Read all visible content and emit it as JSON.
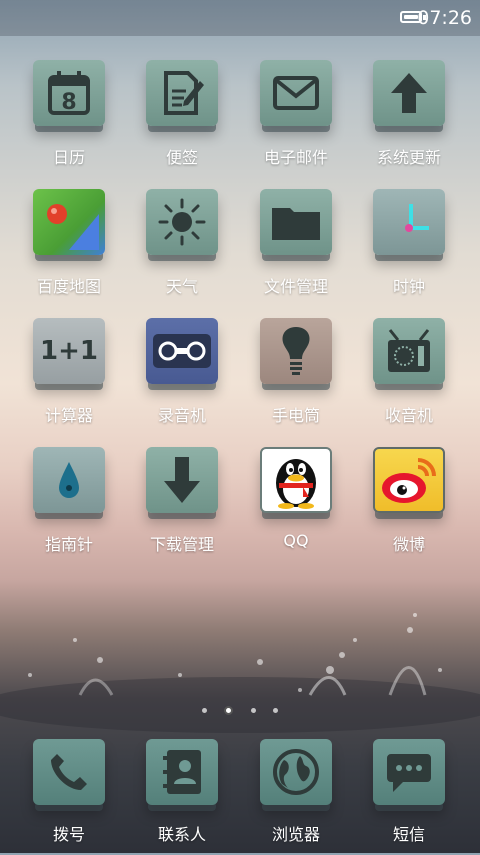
{
  "status_bar": {
    "time": "07:26"
  },
  "apps": [
    [
      {
        "name": "日历",
        "icon": "calendar-icon"
      },
      {
        "name": "便签",
        "icon": "notes-icon"
      },
      {
        "name": "电子邮件",
        "icon": "mail-icon"
      },
      {
        "name": "系统更新",
        "icon": "update-arrow-icon"
      }
    ],
    [
      {
        "name": "百度地图",
        "icon": "map-icon"
      },
      {
        "name": "天气",
        "icon": "weather-sun-icon"
      },
      {
        "name": "文件管理",
        "icon": "folder-icon"
      },
      {
        "name": "时钟",
        "icon": "clock-icon"
      }
    ],
    [
      {
        "name": "计算器",
        "icon": "calculator-icon"
      },
      {
        "name": "录音机",
        "icon": "cassette-icon"
      },
      {
        "name": "手电筒",
        "icon": "flashlight-icon"
      },
      {
        "name": "收音机",
        "icon": "radio-icon"
      }
    ],
    [
      {
        "name": "指南针",
        "icon": "compass-icon"
      },
      {
        "name": "下载管理",
        "icon": "download-icon"
      },
      {
        "name": "QQ",
        "icon": "qq-penguin-icon"
      },
      {
        "name": "微博",
        "icon": "weibo-icon"
      }
    ]
  ],
  "calendar_day": "8",
  "calculator_text": "1+1",
  "page_indicator": {
    "total": 4,
    "active": 1
  },
  "dock": [
    {
      "name": "拨号",
      "icon": "phone-icon"
    },
    {
      "name": "联系人",
      "icon": "contacts-icon"
    },
    {
      "name": "浏览器",
      "icon": "globe-icon"
    },
    {
      "name": "短信",
      "icon": "message-icon"
    }
  ]
}
